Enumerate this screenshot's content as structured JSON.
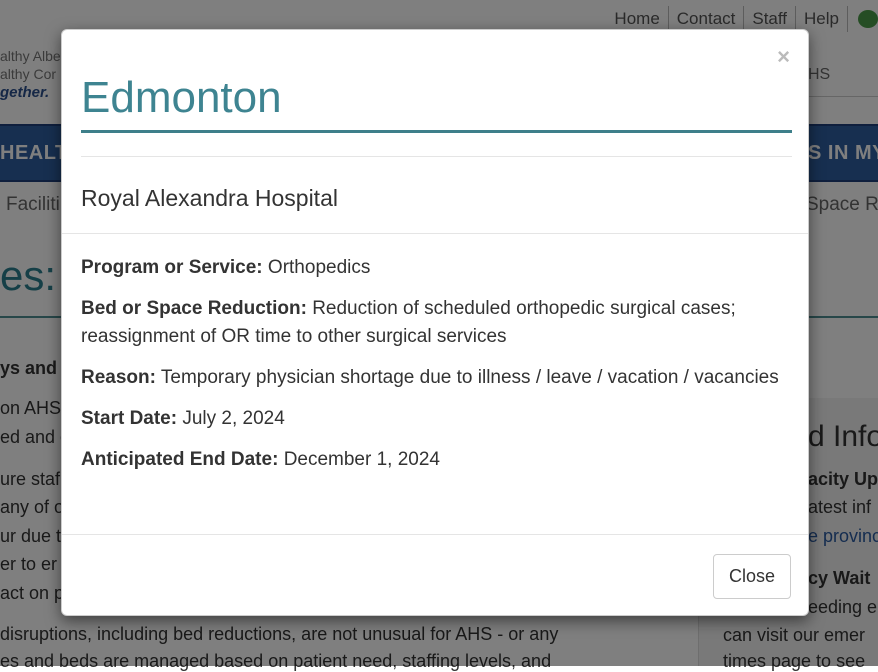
{
  "background": {
    "top_nav": [
      "Home",
      "Contact",
      "Staff",
      "Help"
    ],
    "logo_lines": [
      "althy Albe",
      "althy Cor",
      "gether."
    ],
    "subnav_right": "HS",
    "bar_left": "HEALT",
    "bar_right": "S IN MY",
    "breadcrumb_left": "Faciliti",
    "breadcrumb_right": "Space R",
    "heading_fragment": "es:",
    "left_lines": [
      "ys and",
      "on AHS",
      "ed and c",
      "ure staf",
      "any of o",
      "ur due t",
      "er to er",
      "act on p",
      "disruptions, including bed reductions, are not unusual for AHS - or any",
      "es and beds are managed based on patient need, staffing levels, and"
    ],
    "right_lines": [
      "d Info",
      "acity Up",
      "atest inf",
      "e provinc",
      "cy Wait",
      "eeding e",
      "can visit our emer",
      "times page to see"
    ]
  },
  "modal": {
    "title": "Edmonton",
    "close_symbol": "×",
    "hospital": "Royal Alexandra Hospital",
    "fields": [
      {
        "label": "Program or Service:",
        "value": "Orthopedics"
      },
      {
        "label": "Bed or Space Reduction:",
        "value": "Reduction of scheduled orthopedic surgical cases; reassignment of OR time to other surgical services"
      },
      {
        "label": "Reason:",
        "value": "Temporary physician shortage due to illness / leave / vacation / vacancies"
      },
      {
        "label": "Start Date:",
        "value": "July 2, 2024"
      },
      {
        "label": "Anticipated End Date:",
        "value": "December 1, 2024"
      }
    ],
    "close_button": "Close"
  }
}
